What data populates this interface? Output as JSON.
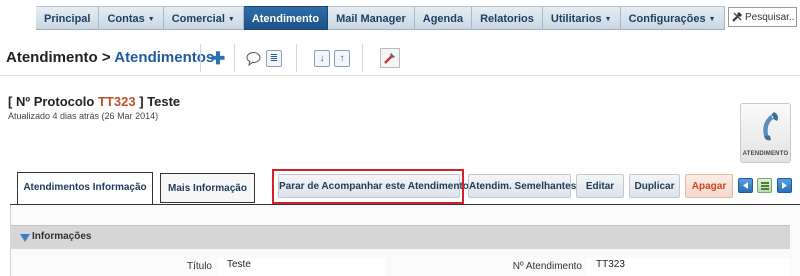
{
  "nav": {
    "items": [
      {
        "label": "Principal",
        "caret": ""
      },
      {
        "label": "Contas",
        "caret": "▼"
      },
      {
        "label": "Comercial",
        "caret": "▼"
      },
      {
        "label": "Atendimento",
        "caret": ""
      },
      {
        "label": "Mail Manager",
        "caret": ""
      },
      {
        "label": "Agenda",
        "caret": ""
      },
      {
        "label": "Relatorios",
        "caret": ""
      },
      {
        "label": "Utilitarios",
        "caret": "▼"
      },
      {
        "label": "Configurações",
        "caret": "▼"
      }
    ],
    "active_index": 3,
    "search_placeholder": "Pesquisar..."
  },
  "breadcrumb": {
    "root": "Atendimento",
    "separator": ">",
    "current": "Atendimentos"
  },
  "record": {
    "title_prefix": "[ Nº Protocolo",
    "protocol": "TT323",
    "title_suffix": "] Teste",
    "updated": "Atualizado 4 dias atrás (26 Mar 2014)",
    "module_label": "ATENDIMENTO"
  },
  "tabs": {
    "info": "Atendimentos Informação",
    "more": "Mais Informação"
  },
  "actions": {
    "stop_follow": "Parar de Acompanhar este Atendimento",
    "similar": "Atendim. Semelhantes",
    "edit": "Editar",
    "duplicate": "Duplicar",
    "delete": "Apagar"
  },
  "section": {
    "title": "Informações"
  },
  "fields": {
    "title_label": "Título",
    "title_value": "Teste",
    "number_label": "Nº Atendimento",
    "number_value": "TT323"
  },
  "colors": {
    "nav_active": "#1d5189",
    "link": "#1f5c9e",
    "protocol": "#c0522a",
    "highlight_box": "#d4202c",
    "delete_text": "#d0451f"
  }
}
